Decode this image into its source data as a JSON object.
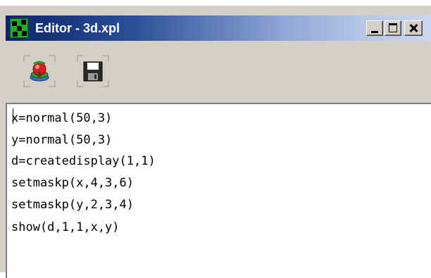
{
  "window": {
    "title": "Editor - 3d.xpl",
    "controls": [
      "minimize",
      "maximize",
      "close"
    ]
  },
  "icons": {
    "app": "xplore-app-icon",
    "run": "execute-icon",
    "save": "floppy-disk-save-icon"
  },
  "editor": {
    "lines": [
      "x=normal(50,3)",
      "y=normal(50,3)",
      "d=createdisplay(1,1)",
      "setmaskp(x,4,3,6)",
      "setmaskp(y,2,3,4)",
      "show(d,1,1,x,y)"
    ]
  },
  "colors": {
    "titlebar_start": "#0a246a",
    "titlebar_end": "#c9d6ef",
    "chrome": "#d4d0c8",
    "editor_bg": "#ffffff"
  }
}
